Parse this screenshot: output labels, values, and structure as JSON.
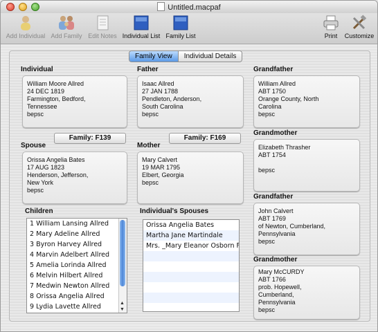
{
  "window": {
    "title": "Untitled.macpaf"
  },
  "toolbar": {
    "add_individual": "Add Individual",
    "add_family": "Add Family",
    "edit_notes": "Edit Notes",
    "individual_list": "Individual List",
    "family_list": "Family List",
    "print": "Print",
    "customize": "Customize"
  },
  "tabs": {
    "family_view": "Family View",
    "individual_details": "Individual Details"
  },
  "individual": {
    "label": "Individual",
    "lines": [
      "William Moore Allred",
      "24 DEC 1819",
      "Farmington, Bedford,",
      "Tennessee",
      "bepsc"
    ]
  },
  "father": {
    "label": "Father",
    "lines": [
      "Isaac Allred",
      "27 JAN 1788",
      "Pendleton, Anderson,",
      "South Carolina",
      "bepsc"
    ]
  },
  "paternal_grandfather": {
    "label": "Grandfather",
    "lines": [
      "William Allred",
      "ABT    1750",
      "Orange County, North",
      "Carolina",
      "bepsc"
    ]
  },
  "paternal_grandmother": {
    "label": "Grandmother",
    "lines": [
      "Elizabeth Thrasher",
      "ABT    1754",
      "",
      "bepsc"
    ]
  },
  "family_buttons": {
    "left": "Family: F139",
    "right": "Family: F169"
  },
  "spouse": {
    "label": "Spouse",
    "lines": [
      "Orissa Angelia Bates",
      "17 AUG 1823",
      "Henderson, Jefferson,",
      "New York",
      "bepsc"
    ]
  },
  "mother": {
    "label": "Mother",
    "lines": [
      "Mary Calvert",
      "19 MAR 1795",
      "Elbert, Georgia",
      "bepsc"
    ]
  },
  "maternal_grandfather": {
    "label": "Grandfather",
    "lines": [
      "John Calvert",
      "ABT    1769",
      "of Newton, Cumberland,",
      "Pennsylvania",
      "bepsc"
    ]
  },
  "maternal_grandmother": {
    "label": "Grandmother",
    "lines": [
      "Mary McCURDY",
      "ABT    1766",
      "prob. Hopewell,",
      "Cumberland,",
      "Pennsylvania",
      "bepsc"
    ]
  },
  "children": {
    "label": "Children",
    "items": [
      "1 William Lansing Allred",
      "2 Mary Adeline Allred",
      "3 Byron Harvey Allred",
      "4 Marvin Adelbert Allred",
      "5 Amelia Lorinda Allred",
      "6 Melvin Hilbert Allred",
      "7 Medwin Newton Allred",
      "8 Orissa Angelia Allred",
      "9 Lydia Lavette Allred"
    ]
  },
  "spouses": {
    "label": "Individual's Spouses",
    "items": [
      "Orissa Angelia Bates",
      "Martha Jane Martindale",
      "Mrs. _Mary Eleanor Osborn F"
    ]
  }
}
